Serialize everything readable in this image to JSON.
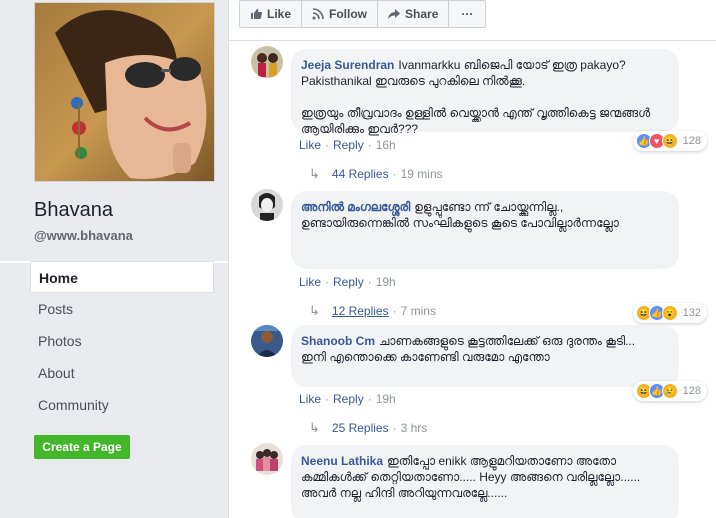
{
  "page": {
    "name": "Bhavana",
    "handle": "@www.bhavana"
  },
  "nav": {
    "items": [
      "Home",
      "Posts",
      "Photos",
      "About",
      "Community"
    ],
    "active": "Home"
  },
  "create_page_label": "Create a Page",
  "actions": {
    "like": "Like",
    "follow": "Follow",
    "share": "Share",
    "more": "···"
  },
  "comments": [
    {
      "author": "Jeeja Surendran",
      "text": "Ivanmarkku ബിജെപി യോട് ഇത്ര pakayo? Pakisthanikal ഇവരുടെ പുറകിലെ നിൽക്കൂ.\n\nഇത്രയും തീവ്രവാദം ഉള്ളിൽ വെയ്ക്കാൻ എന്ത് വൃത്തികെട്ട ജന്മങ്ങൾ ആയിരിക്കും ഇവർ???",
      "like_label": "Like",
      "reply_label": "Reply",
      "time": "16h",
      "reaction_count": "128",
      "reactions": [
        "like",
        "love",
        "haha"
      ],
      "replies_label": "44 Replies",
      "replies_time": "19 mins"
    },
    {
      "author": "അനിൽ മംഗലശ്ശേരി",
      "text": "ഉളുപ്പുണ്ടോ ന്ന് ചോയ്ക്കുന്നില്ല.,\nഉണ്ടായിരുന്നെങ്കിൽ സംഘികളുടെ കൂടെ പോവില്ലാർന്നല്ലോ",
      "like_label": "Like",
      "reply_label": "Reply",
      "time": "19h",
      "reaction_count": "132",
      "reactions": [
        "haha",
        "like",
        "wow"
      ],
      "replies_label": "12 Replies",
      "replies_time": "7 mins"
    },
    {
      "author": "Shanoob Cm",
      "text": "ചാണകങ്ങളുടെ കൂട്ടത്തിലേക്ക് ഒരു ദുരന്തം കൂടി...\nഇനി എന്തൊക്കെ കാണേണ്ടി വരുമോ എന്തോ",
      "like_label": "Like",
      "reply_label": "Reply",
      "time": "19h",
      "reaction_count": "128",
      "reactions": [
        "haha",
        "like",
        "sad"
      ],
      "replies_label": "25 Replies",
      "replies_time": "3 hrs"
    },
    {
      "author": "Neenu Lathika",
      "text": "ഇതിപ്പോ enikk ആളുമറിയതാണോ അതോ കമ്മികൾക്ക് തെറ്റിയതാണോ..... Heyy അങ്ങനെ വരില്ലല്ലോ...... അവർ നല്ല ഹിന്ദി അറിയുന്നവരല്ലേ......"
    }
  ],
  "colors": {
    "link": "#385898",
    "green": "#42b72a",
    "bg": "#e9ebee"
  }
}
